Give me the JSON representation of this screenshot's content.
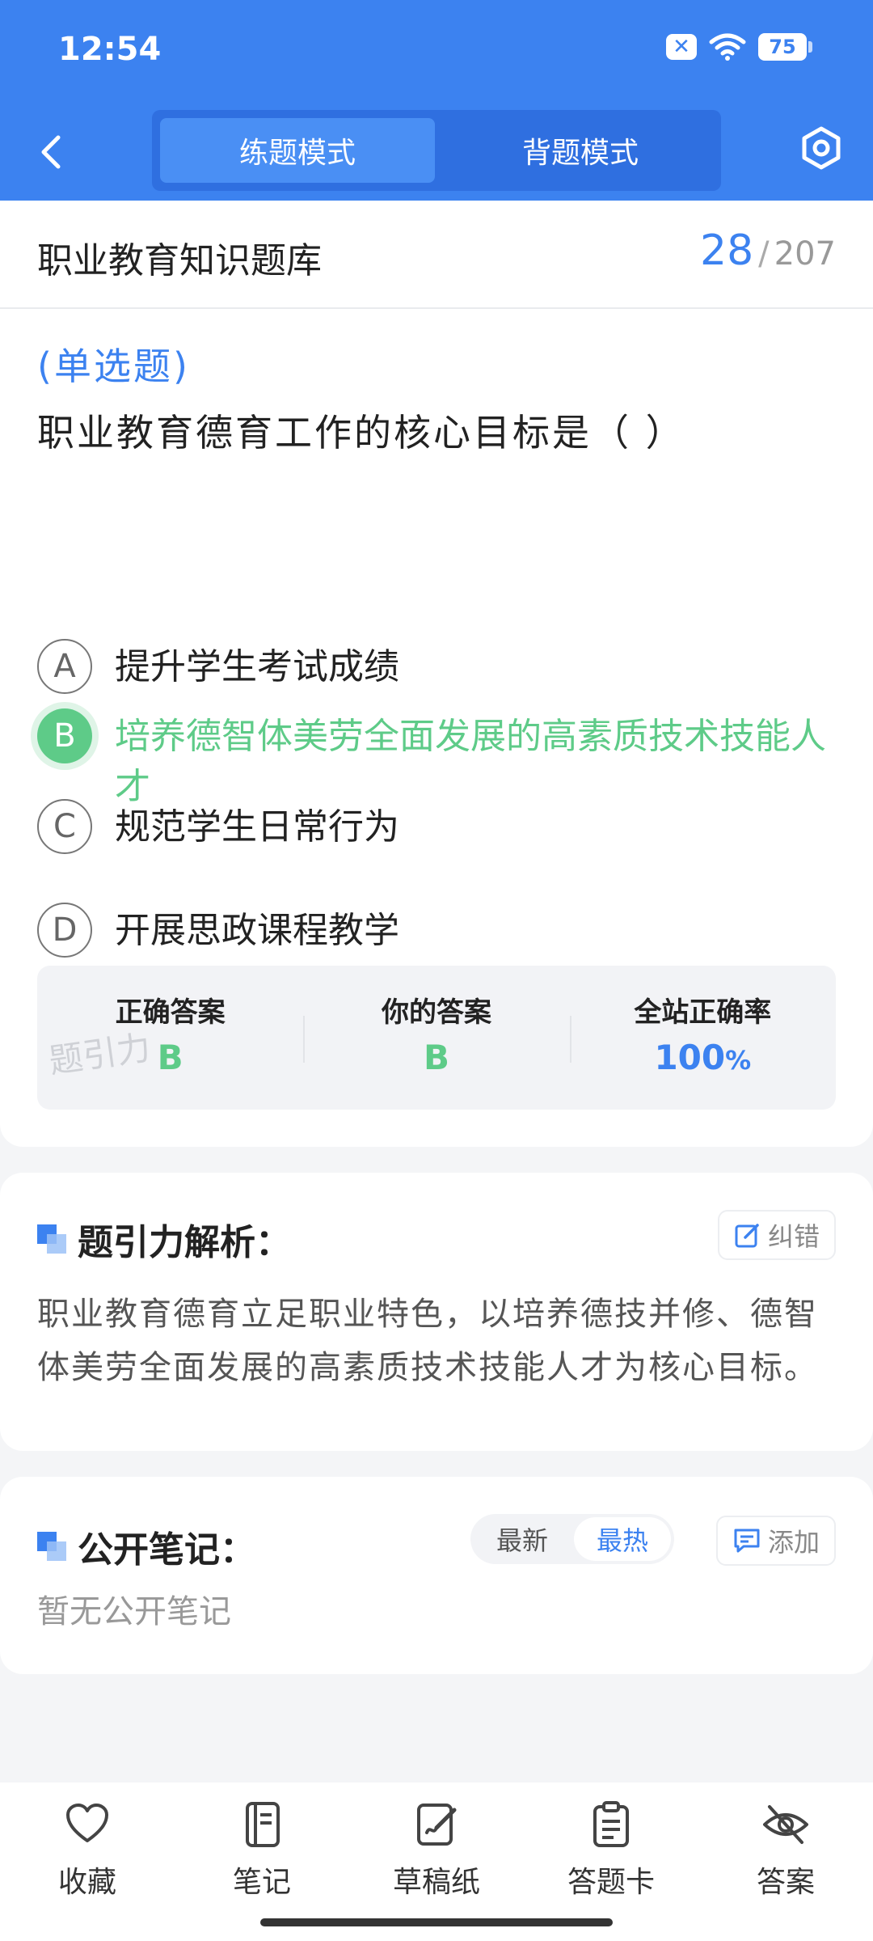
{
  "status_bar": {
    "time": "12:54",
    "battery": "75"
  },
  "header": {
    "tabs": [
      {
        "label": "练题模式",
        "active": true
      },
      {
        "label": "背题模式",
        "active": false
      }
    ]
  },
  "title_bar": {
    "bank_name": "职业教育知识题库",
    "current": "28",
    "total": "207"
  },
  "question": {
    "type": "(单选题)",
    "text": "职业教育德育工作的核心目标是（    ）",
    "options": [
      {
        "letter": "A",
        "text": "提升学生考试成绩"
      },
      {
        "letter": "B",
        "text": "培养德智体美劳全面发展的高素质技术技能人才"
      },
      {
        "letter": "C",
        "text": "规范学生日常行为"
      },
      {
        "letter": "D",
        "text": "开展思政课程教学"
      }
    ],
    "correct_option": "B"
  },
  "stats": {
    "correct_label": "正确答案",
    "correct_value": "B",
    "yours_label": "你的答案",
    "yours_value": "B",
    "rate_label": "全站正确率",
    "rate_value": "100",
    "rate_unit": "%"
  },
  "watermark": "题引力",
  "analysis": {
    "title": "题引力解析：",
    "correct_button": "纠错",
    "text": "职业教育德育立足职业特色，以培养德技并修、德智体美劳全面发展的高素质技术技能人才为核心目标。"
  },
  "notes": {
    "title": "公开笔记：",
    "sort": {
      "latest": "最新",
      "hot": "最热",
      "selected": "最热"
    },
    "add_button": "添加",
    "empty_text": "暂无公开笔记"
  },
  "bottom_nav": [
    {
      "label": "收藏",
      "icon": "heart-icon"
    },
    {
      "label": "笔记",
      "icon": "notebook-icon"
    },
    {
      "label": "草稿纸",
      "icon": "draft-icon"
    },
    {
      "label": "答题卡",
      "icon": "answer-sheet-icon"
    },
    {
      "label": "答案",
      "icon": "eye-off-icon"
    }
  ],
  "colors": {
    "primary": "#3c82f0",
    "correct": "#5ecb88",
    "background": "#f4f5f7"
  }
}
